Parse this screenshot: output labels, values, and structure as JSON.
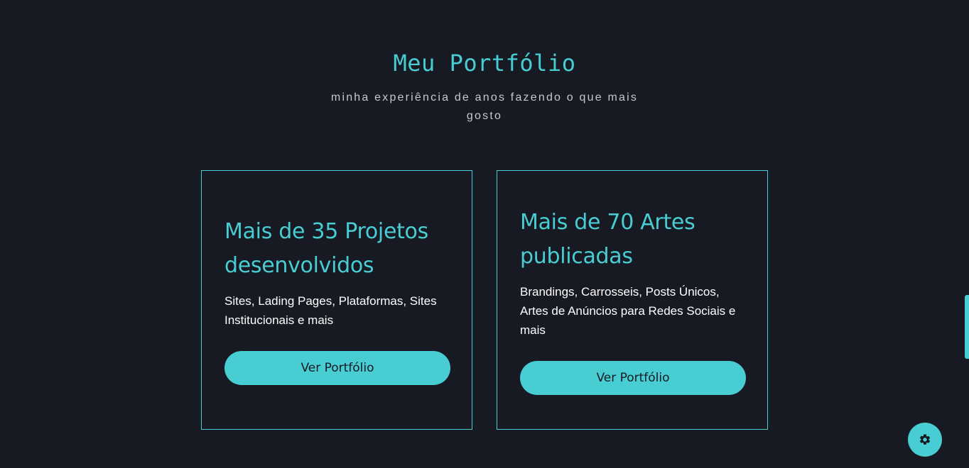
{
  "section": {
    "title": "Meu Portfólio",
    "subtitle": "minha experiência de anos fazendo o que mais gosto"
  },
  "cards": [
    {
      "title": "Mais de 35 Projetos desenvolvidos",
      "description": "Sites, Lading Pages, Plataformas, Sites Institucionais e mais",
      "button_label": "Ver Portfólio"
    },
    {
      "title": "Mais de 70 Artes publicadas",
      "description": "Brandings, Carrosseis, Posts Únicos, Artes de Anúncios para Redes Sociais e mais",
      "button_label": "Ver Portfólio"
    }
  ],
  "settings_button": {
    "icon": "gear-icon"
  },
  "colors": {
    "background": "#171923",
    "accent": "#48cdd2",
    "text": "#ffffff",
    "muted": "#c7c9d1"
  }
}
